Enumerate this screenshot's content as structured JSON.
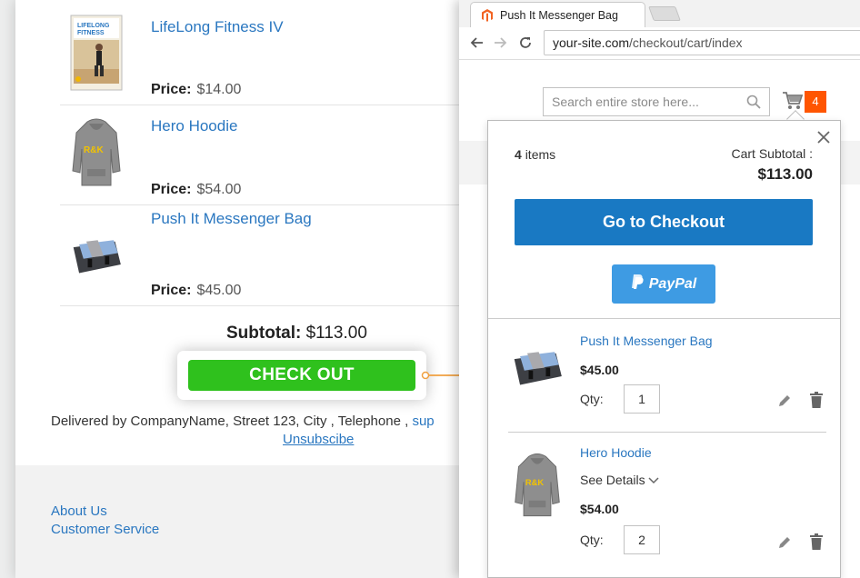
{
  "email": {
    "items": [
      {
        "name": "LifeLong Fitness IV",
        "price_label": "Price:",
        "price": "$14.00",
        "thumb_icon": "dvd-cover-icon"
      },
      {
        "name": "Hero Hoodie",
        "price_label": "Price:",
        "price": "$54.00",
        "thumb_icon": "hoodie-icon"
      },
      {
        "name": "Push It Messenger Bag",
        "price_label": "Price:",
        "price": "$45.00",
        "thumb_icon": "messenger-bag-icon"
      }
    ],
    "subtotal_label": "Subtotal:",
    "subtotal_value": "$113.00",
    "checkout_label": "CHECK OUT",
    "delivered_text": "Delivered by CompanyName, Street 123, City , Telephone ,",
    "support_link": "sup",
    "unsubscribe": "Unsubscibe",
    "footer_links": [
      "About Us",
      "Customer Service"
    ],
    "colors": {
      "checkout": "#2fc11d",
      "link": "#2a77c0",
      "arrow": "#f0a040"
    }
  },
  "browser": {
    "tab_title": "Push It Messenger Bag",
    "url_host": "your-site.com",
    "url_path": "/checkout/cart/index"
  },
  "store": {
    "search_placeholder": "Search entire store here...",
    "cart_count": "4",
    "minicart": {
      "count": "4",
      "count_suffix": "items",
      "subtotal_label": "Cart Subtotal :",
      "subtotal_value": "$113.00",
      "checkout_label": "Go to Checkout",
      "paypal_label": "PayPal",
      "qty_label": "Qty:",
      "items": [
        {
          "name": "Push It Messenger Bag",
          "price": "$45.00",
          "qty": "1"
        },
        {
          "name": "Hero Hoodie",
          "details": "See Details",
          "price": "$54.00",
          "qty": "2"
        }
      ]
    },
    "colors": {
      "primary": "#1979c3",
      "badge": "#ff5501",
      "paypal": "#3e9be3"
    }
  }
}
